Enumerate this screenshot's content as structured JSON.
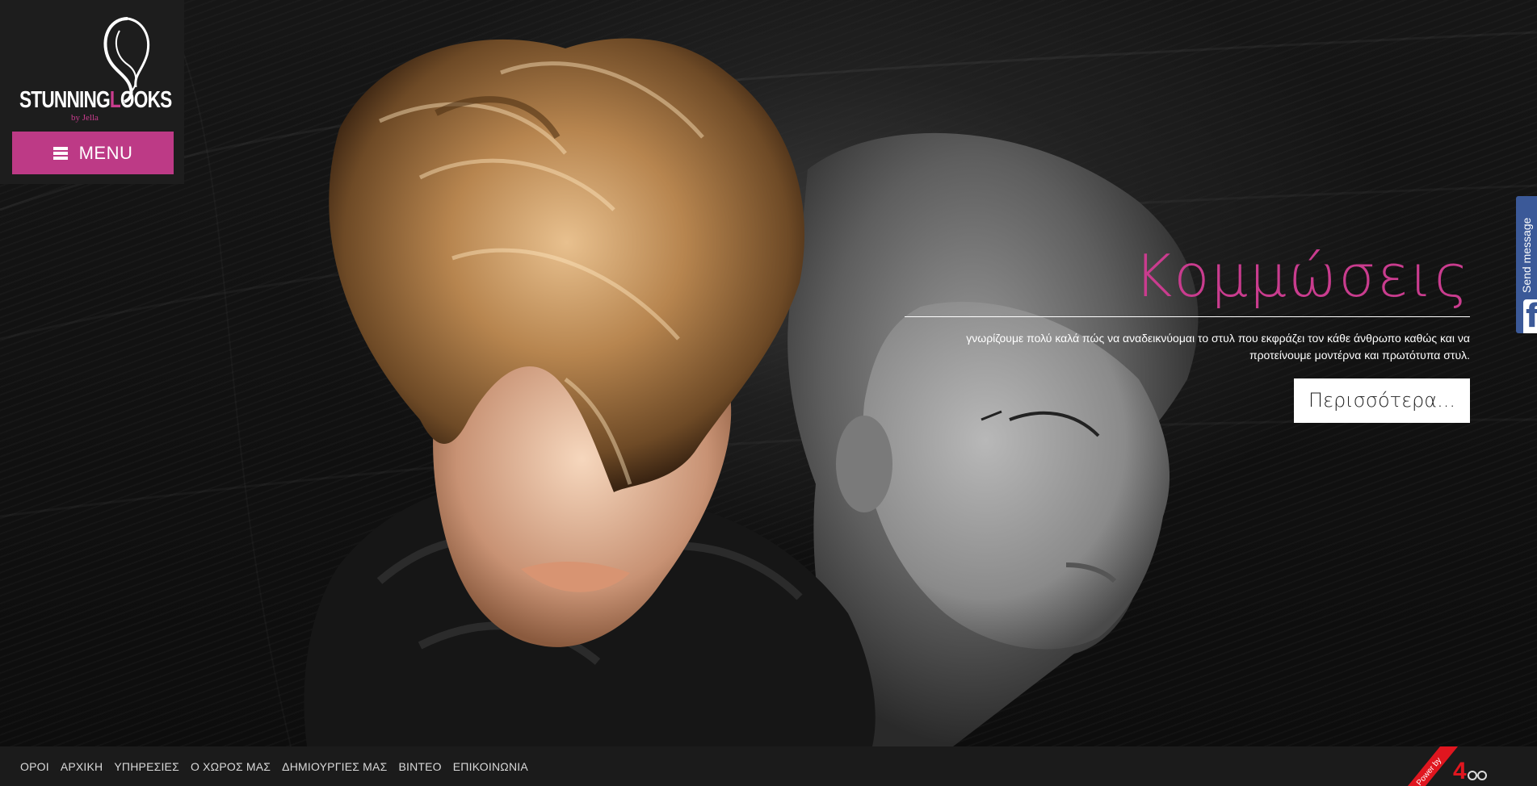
{
  "brand": {
    "logo_main_white": "STUNNING",
    "logo_main_pink": "L",
    "logo_main_white2": "OOKS",
    "logo_sub": "by Jella",
    "accent": "#c93c8e"
  },
  "menu": {
    "label": "MENU",
    "icon": "hamburger-icon"
  },
  "slide": {
    "title": "Κομμώσεις",
    "text": "γνωρίζουμε πολύ καλά πώς να αναδεικνύομαι το στυλ που εκφράζει τον κάθε άνθρωπο καθώς και να προτείνουμε μοντέρνα και πρωτότυπα στυλ.",
    "button": "Περισσότερα..."
  },
  "facebook_tab": {
    "label": "Send message",
    "icon": "facebook-icon",
    "color": "#3b5998"
  },
  "footer": {
    "links": [
      "ΟΡΟΙ",
      "ΑΡΧΙΚΗ",
      "ΥΠΗΡΕΣΙΕΣ",
      "Ο ΧΩΡΟΣ ΜΑΣ",
      "ΔΗΜΙΟΥΡΓΙΕΣ ΜΑΣ",
      "ΒΙΝΤΕΟ",
      "ΕΠΙΚΟΙΝΩΝΙΑ"
    ],
    "badge_text": "Power by",
    "badge_logo": "4"
  }
}
